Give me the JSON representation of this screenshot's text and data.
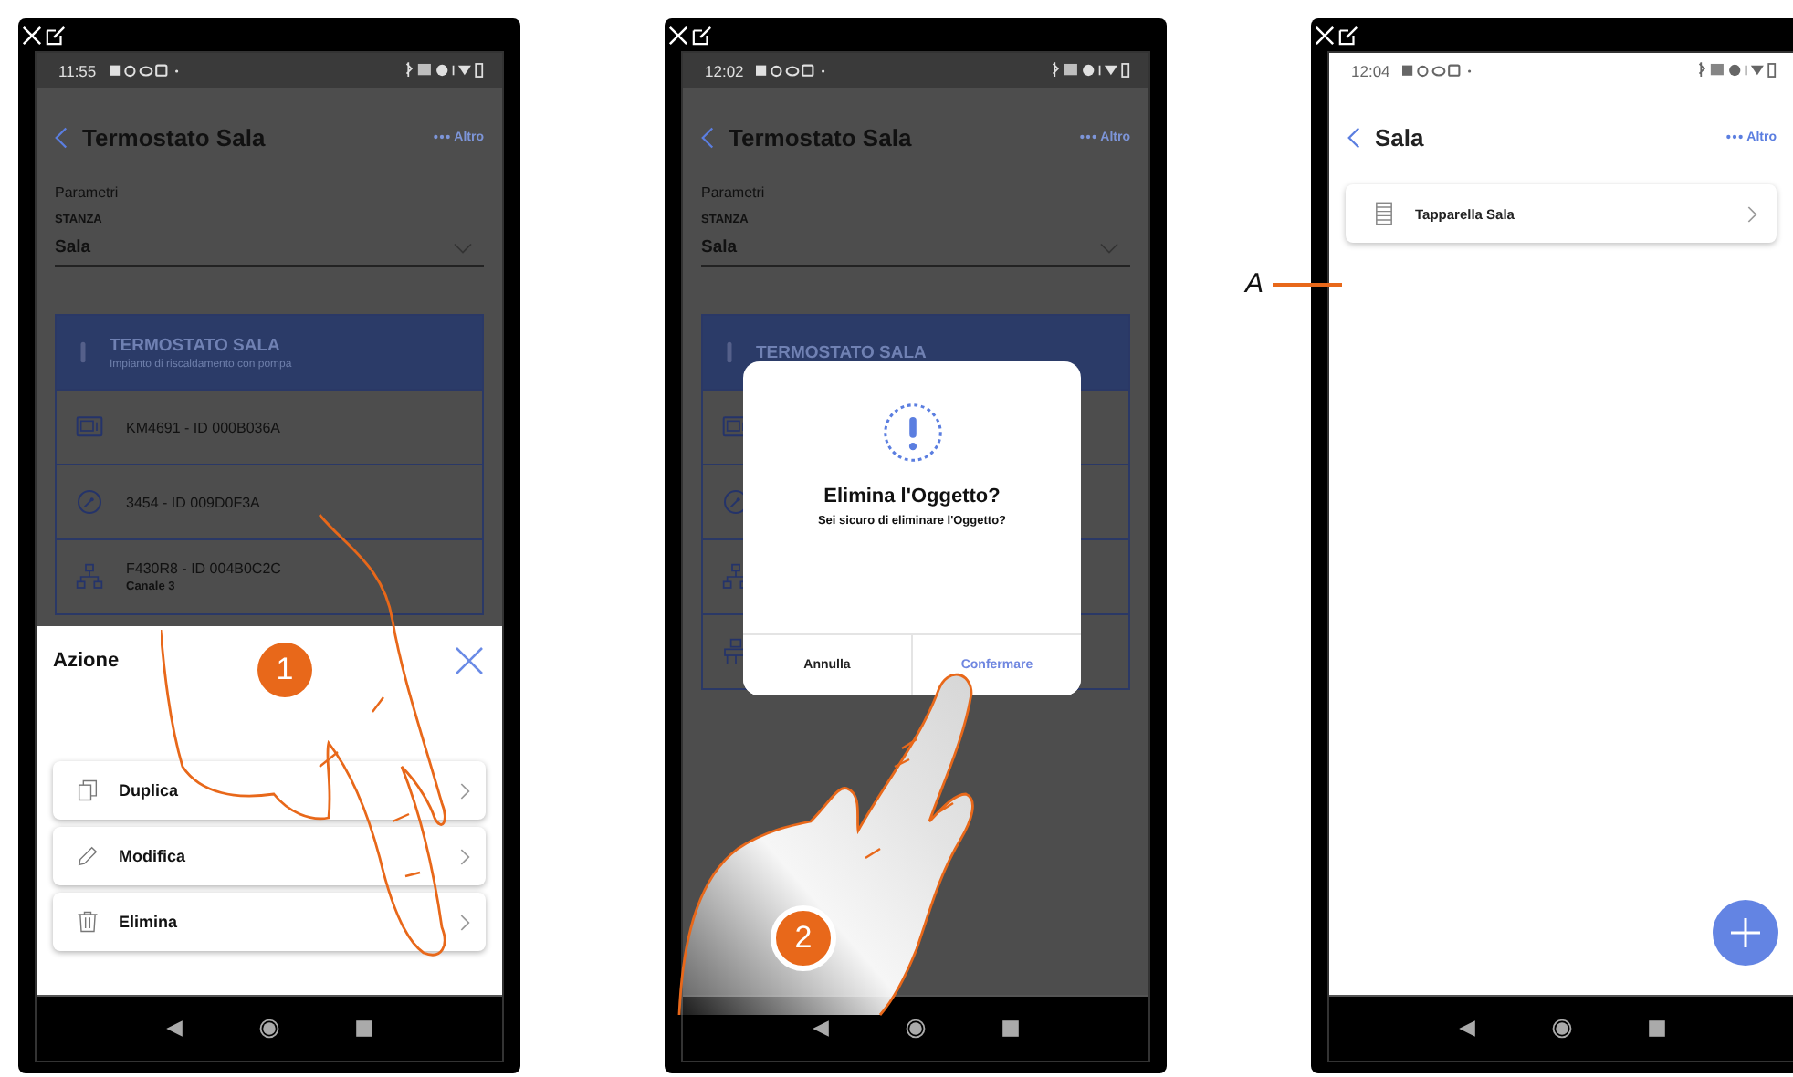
{
  "phones": [
    {
      "kind": "detail",
      "dimmed": true,
      "status_time": "11:55",
      "header": {
        "title": "Termostato Sala",
        "more": "Altro"
      },
      "section": "Parametri",
      "field_label": "STANZA",
      "field_value": "Sala",
      "device": {
        "title": "TERMOSTATO SALA",
        "subtitle": "Impianto di riscaldamento con pompa"
      },
      "items": [
        {
          "kind": "display",
          "label": "KM4691 - ID 000B036A"
        },
        {
          "kind": "gauge",
          "label": "3454 - ID 009D0F3A"
        },
        {
          "kind": "network",
          "label": "F430R8 - ID 004B0C2C",
          "sub": "Canale 3"
        }
      ],
      "sheet": {
        "title": "Azione",
        "actions": [
          {
            "kind": "copy",
            "label": "Duplica"
          },
          {
            "kind": "edit",
            "label": "Modifica"
          },
          {
            "kind": "delete",
            "label": "Elimina"
          }
        ]
      },
      "step": "1"
    },
    {
      "kind": "detail",
      "dimmed": true,
      "status_time": "12:02",
      "header": {
        "title": "Termostato Sala",
        "more": "Altro"
      },
      "section": "Parametri",
      "field_label": "STANZA",
      "field_value": "Sala",
      "device": {
        "title": "TERMOSTATO SALA"
      },
      "items": [
        {
          "kind": "display"
        },
        {
          "kind": "gauge"
        },
        {
          "kind": "network"
        },
        {
          "kind": "cluster"
        }
      ],
      "dialog": {
        "title": "Elimina l'Oggetto?",
        "message": "Sei sicuro di eliminare l'Oggetto?",
        "buttons": [
          {
            "label": "Annulla",
            "primary": false
          },
          {
            "label": "Confermare",
            "primary": true
          }
        ]
      },
      "step": "2"
    },
    {
      "kind": "list",
      "dimmed": false,
      "status_time": "12:04",
      "header": {
        "title": "Sala",
        "more": "Altro"
      },
      "items": [
        {
          "kind": "shutter",
          "label": "Tapparella Sala"
        }
      ],
      "fab": true,
      "callout": "A"
    }
  ]
}
